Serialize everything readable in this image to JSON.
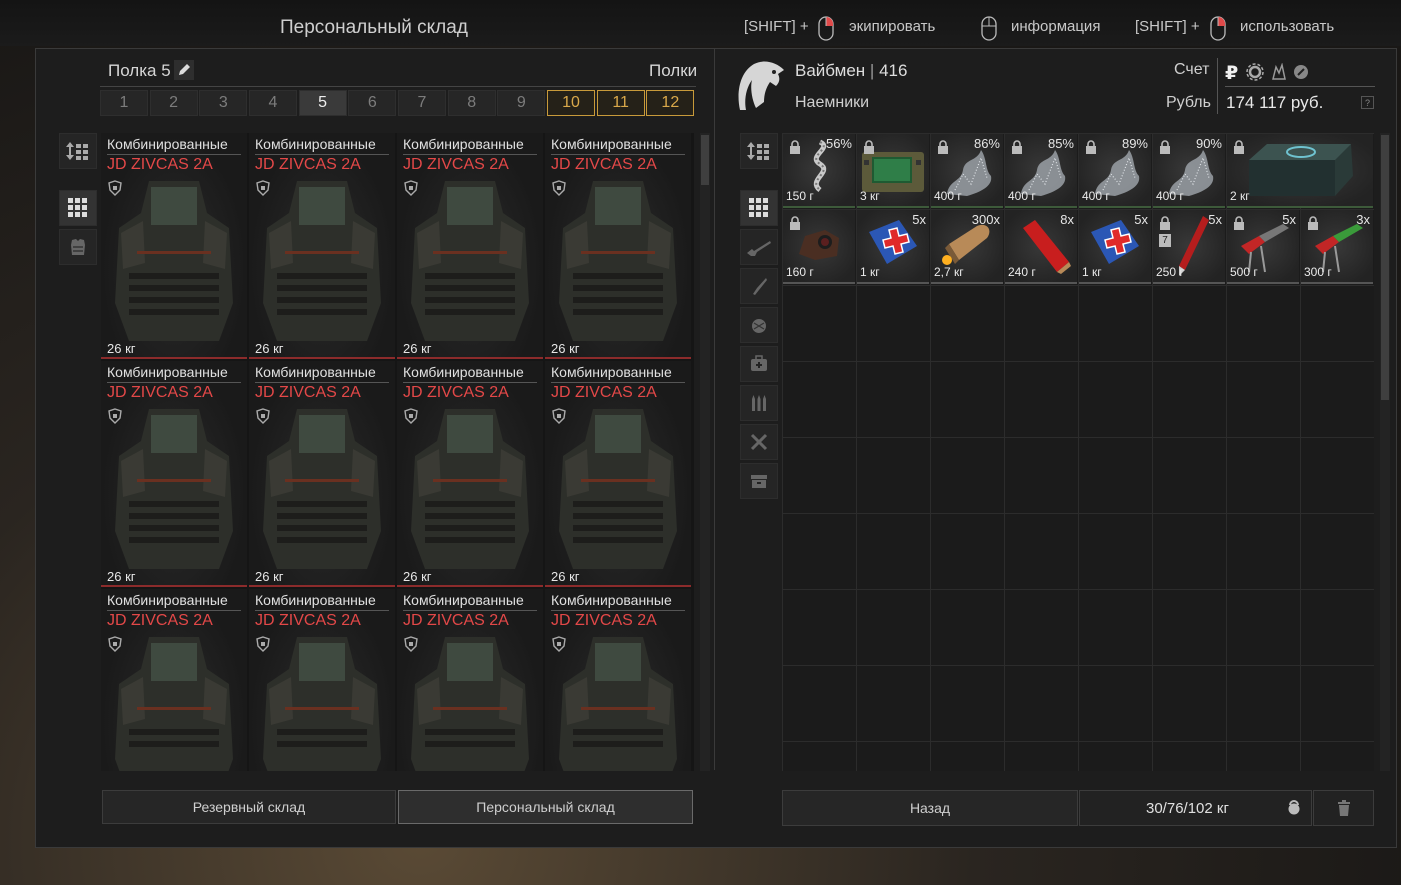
{
  "window_title": "Персональный склад",
  "hints": [
    {
      "prefix": "[SHIFT] +",
      "action": "экипировать"
    },
    {
      "prefix": "",
      "action": "информация"
    },
    {
      "prefix": "[SHIFT] +",
      "action": "использовать"
    }
  ],
  "left": {
    "shelf_label": "Полка 5",
    "shelves_label": "Полки",
    "tabs": [
      "1",
      "2",
      "3",
      "4",
      "5",
      "6",
      "7",
      "8",
      "9",
      "10",
      "11",
      "12"
    ],
    "active_tab": "5",
    "gold_tabs": [
      "10",
      "11",
      "12"
    ],
    "items": [
      {
        "category": "Комбинированные",
        "name": "JD ZIVCAS 2A",
        "weight": "26 кг"
      },
      {
        "category": "Комбинированные",
        "name": "JD ZIVCAS 2A",
        "weight": "26 кг"
      },
      {
        "category": "Комбинированные",
        "name": "JD ZIVCAS 2A",
        "weight": "26 кг"
      },
      {
        "category": "Комбинированные",
        "name": "JD ZIVCAS 2A",
        "weight": "26 кг"
      },
      {
        "category": "Комбинированные",
        "name": "JD ZIVCAS 2A",
        "weight": "26 кг"
      },
      {
        "category": "Комбинированные",
        "name": "JD ZIVCAS 2A",
        "weight": "26 кг"
      },
      {
        "category": "Комбинированные",
        "name": "JD ZIVCAS 2A",
        "weight": "26 кг"
      },
      {
        "category": "Комбинированные",
        "name": "JD ZIVCAS 2A",
        "weight": "26 кг"
      },
      {
        "category": "Комбинированные",
        "name": "JD ZIVCAS 2A",
        "weight": ""
      },
      {
        "category": "Комбинированные",
        "name": "JD ZIVCAS 2A",
        "weight": ""
      },
      {
        "category": "Комбинированные",
        "name": "JD ZIVCAS 2A",
        "weight": ""
      },
      {
        "category": "Комбинированные",
        "name": "JD ZIVCAS 2A",
        "weight": ""
      }
    ],
    "buttons": {
      "reserve": "Резервный склад",
      "personal": "Персональный склад"
    }
  },
  "right": {
    "character": {
      "name": "Вайбмен",
      "level": "416",
      "faction": "Наемники"
    },
    "account_label": "Счет",
    "currency_label": "Рубль",
    "money": "174 117 руб.",
    "help": "?",
    "items": [
      {
        "icon": "artifact-spiral-icon",
        "locked": true,
        "pct": "56%",
        "qty": "",
        "weight": "150 г",
        "badge": ""
      },
      {
        "icon": "detector-device-icon",
        "locked": true,
        "pct": "",
        "qty": "",
        "weight": "3 кг",
        "badge": ""
      },
      {
        "icon": "artifact-crystal-icon",
        "locked": true,
        "pct": "86%",
        "qty": "",
        "weight": "400 г",
        "badge": ""
      },
      {
        "icon": "artifact-crystal-icon",
        "locked": true,
        "pct": "85%",
        "qty": "",
        "weight": "400 г",
        "badge": ""
      },
      {
        "icon": "artifact-crystal-icon",
        "locked": true,
        "pct": "89%",
        "qty": "",
        "weight": "400 г",
        "badge": ""
      },
      {
        "icon": "artifact-crystal-icon",
        "locked": true,
        "pct": "90%",
        "qty": "",
        "weight": "400 г",
        "badge": ""
      },
      {
        "icon": "container-case-icon",
        "locked": true,
        "pct": "",
        "qty": "",
        "weight": "2 кг",
        "badge": ""
      },
      {
        "icon": "scope-sight-icon",
        "locked": true,
        "pct": "",
        "qty": "",
        "weight": "160 г",
        "badge": ""
      },
      {
        "icon": "medkit-icon",
        "locked": false,
        "pct": "",
        "qty": "5x",
        "weight": "1 кг",
        "badge": ""
      },
      {
        "icon": "bullet-ammo-icon",
        "locked": false,
        "pct": "",
        "qty": "300x",
        "weight": "2,7 кг",
        "badge": ""
      },
      {
        "icon": "shotgun-shell-icon",
        "locked": false,
        "pct": "",
        "qty": "8x",
        "weight": "240 г",
        "badge": ""
      },
      {
        "icon": "medkit-icon",
        "locked": false,
        "pct": "",
        "qty": "5x",
        "weight": "1 кг",
        "badge": ""
      },
      {
        "icon": "syringe-icon",
        "locked": true,
        "pct": "",
        "qty": "5x",
        "weight": "250 г",
        "badge": "7"
      },
      {
        "icon": "bolt-cutter-icon",
        "locked": true,
        "pct": "",
        "qty": "5x",
        "weight": "500 г",
        "badge": ""
      },
      {
        "icon": "bolt-cutter-green-icon",
        "locked": true,
        "pct": "",
        "qty": "3x",
        "weight": "300 г",
        "badge": ""
      }
    ],
    "back_button": "Назад",
    "weight": "30/76/102 кг"
  }
}
